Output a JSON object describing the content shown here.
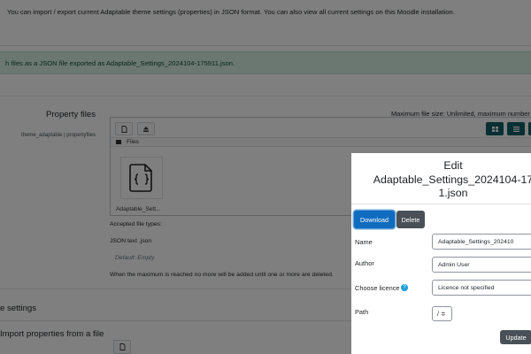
{
  "page": {
    "intro_text": "You can import / export current Adaptable theme settings (properties) in JSON format. You can also view all current settings on this Moodle installation.",
    "alert_text": "h files as a JSON file exported as Adaptable_Settings_2024104-175911.json.",
    "property_files_label": "Property files",
    "property_files_sub": "theme_adaptable | propertyfiles",
    "max_file_size": "Maximum file size: Unlimited, maximum number o",
    "filepicker": {
      "path_label": "Files",
      "file_name": "Adaptable_Sett..."
    },
    "accepted_types_label": "Accepted file types:",
    "accepted_type": "JSON text .json",
    "default_text": "Default: Empty",
    "max_reached_text": "When the maximum is reached no more will be added until one or more are deleted.",
    "section_settings": "e settings",
    "section_import": "Import properties from a file"
  },
  "dialog": {
    "title_line1": "Edit",
    "title_line2": "Adaptable_Settings_2024104-17",
    "title_line3": "1.json",
    "download_label": "Download",
    "delete_label": "Delete",
    "name_label": "Name",
    "name_value": "Adaptable_Settings_202410",
    "author_label": "Author",
    "author_value": "Admin User",
    "licence_label": "Choose licence",
    "licence_value": "Licence not specified",
    "path_label": "Path",
    "path_value": "/ ≑",
    "update_label": "Update"
  },
  "icons": [
    "document-icon",
    "upload-icon",
    "folder-icon",
    "json-file-icon",
    "grid-view-icon",
    "list-view-icon",
    "help-icon"
  ],
  "colors": {
    "primary": "#0f6cbf",
    "secondary": "#495057",
    "teal": "#115e67",
    "alert_bg": "#d7efe3",
    "help": "#1f9fd9"
  }
}
